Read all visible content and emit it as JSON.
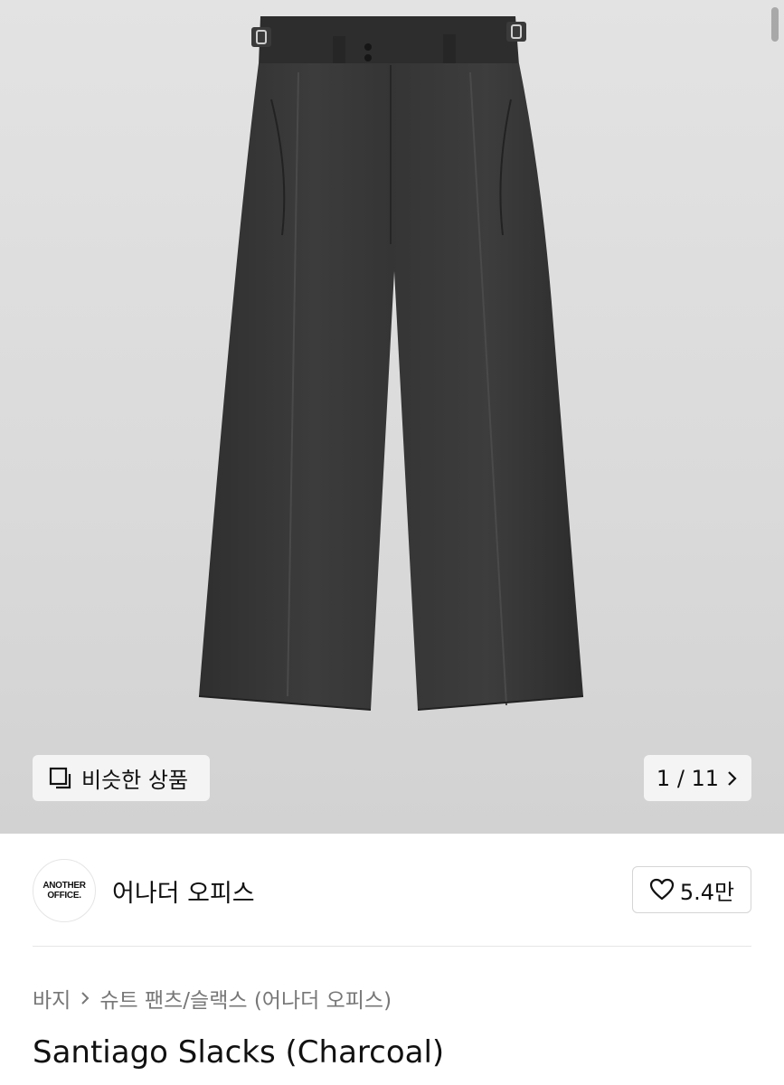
{
  "hero": {
    "image_alt": "charcoal wide pleated slacks",
    "similar_button_label": "비슷한 상품",
    "image_counter": "1 / 11"
  },
  "brand": {
    "logo_line1": "ANOTHER",
    "logo_line2": "OFFICE.",
    "name": "어나더 오피스",
    "likes": "5.4만"
  },
  "breadcrumb": {
    "items": [
      "바지",
      "슈트 팬츠/슬랙스 (어나더 오피스)"
    ]
  },
  "product": {
    "title": "Santiago Slacks (Charcoal)"
  },
  "icons": {
    "similar": "similar-products-icon",
    "next": "chevron-right-icon",
    "like": "heart-icon",
    "separator": "chevron-right-icon"
  },
  "colors": {
    "hero_bg": "#dcdcdc",
    "pants": "#333333",
    "chip_bg": "#f4f4f4"
  }
}
